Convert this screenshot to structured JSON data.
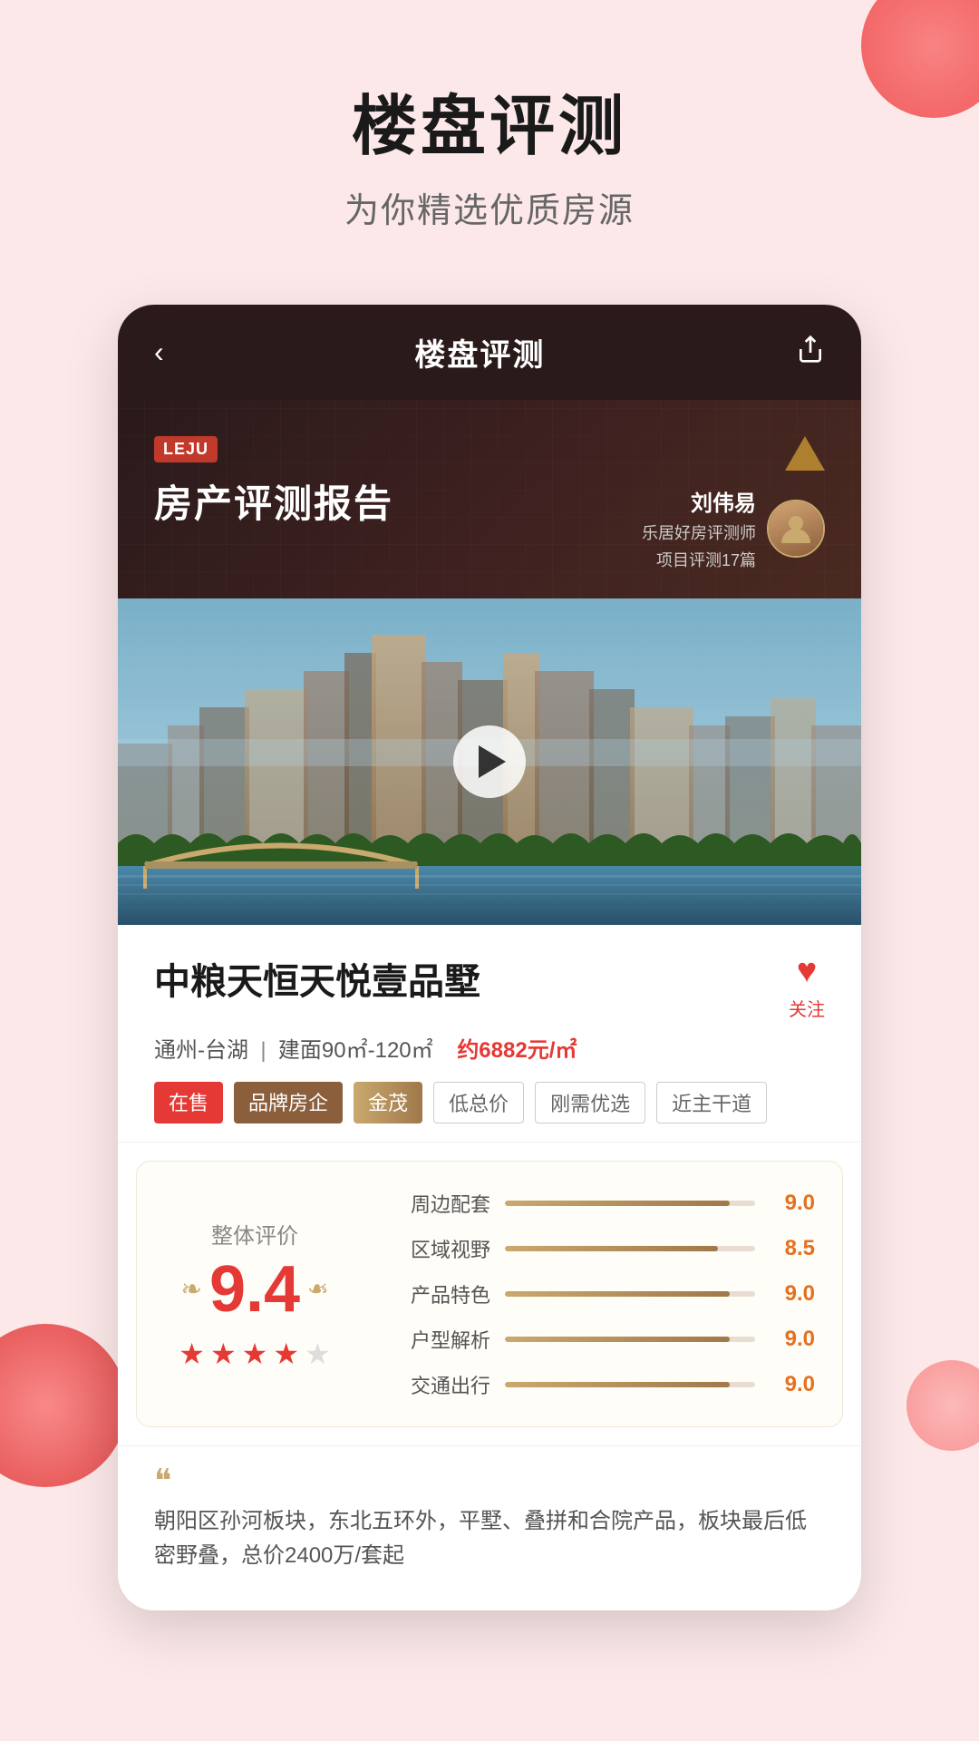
{
  "background": {
    "color": "#fce8e8"
  },
  "hero": {
    "title": "楼盘评测",
    "subtitle": "为你精选优质房源"
  },
  "app_header": {
    "back_label": "‹",
    "title": "楼盘评测",
    "share_label": "⎋"
  },
  "report_banner": {
    "logo_text": "LEJU",
    "title": "房产评测报告",
    "reviewer_name": "刘伟易",
    "reviewer_desc1": "乐居好房评测师",
    "reviewer_desc2": "项目评测17篇"
  },
  "video": {
    "play_hint": "播放视频"
  },
  "property": {
    "name": "中粮天恒天悦壹品墅",
    "location": "通州-台湖",
    "area": "建面90㎡-120㎡",
    "price": "约6882元/㎡",
    "favorite_label": "关注",
    "tags": [
      {
        "text": "在售",
        "type": "on-sale"
      },
      {
        "text": "品牌房企",
        "type": "brand"
      },
      {
        "text": "金茂",
        "type": "brand-special"
      },
      {
        "text": "低总价",
        "type": "outline"
      },
      {
        "text": "刚需优选",
        "type": "outline"
      },
      {
        "text": "近主干道",
        "type": "outline"
      }
    ]
  },
  "ratings": {
    "overall_label": "整体评价",
    "overall_score": "9.4",
    "stars": [
      1,
      1,
      1,
      0.5,
      0
    ],
    "items": [
      {
        "label": "周边配套",
        "score": "9.0",
        "percent": 90
      },
      {
        "label": "区域视野",
        "score": "8.5",
        "percent": 85
      },
      {
        "label": "产品特色",
        "score": "9.0",
        "percent": 90
      },
      {
        "label": "户型解析",
        "score": "9.0",
        "percent": 90
      },
      {
        "label": "交通出行",
        "score": "9.0",
        "percent": 90
      }
    ]
  },
  "quote": {
    "text": "朝阳区孙河板块，东北五环外，平墅、叠拼和合院产品，板块最后低密野叠，总价2400万/套起"
  }
}
